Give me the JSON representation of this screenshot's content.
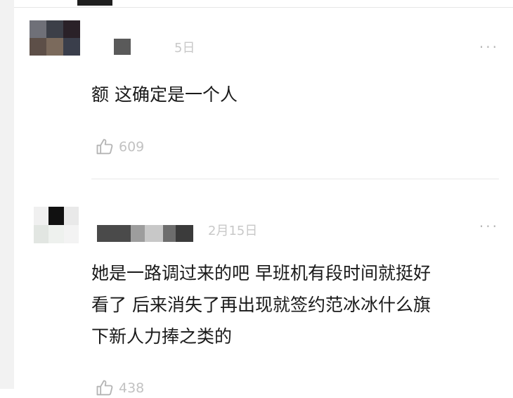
{
  "comments": [
    {
      "time": "5日",
      "text": "额 这确定是一个人",
      "likes": "609",
      "avatar_colors": [
        "#6f7078",
        "#3c3f48",
        "#2a2128",
        "#5d4f48",
        "#7b6a5c",
        "#3a3e4b"
      ],
      "name_block_colors": [
        "#5a5a5a"
      ]
    },
    {
      "time": "2月15日",
      "text_lines": [
        "她是一路调过来的吧 早班机有段时间就挺好",
        "看了 后来消失了再出现就签约范冰冰什么旗",
        "下新人力捧之类的"
      ],
      "likes": "438",
      "avatar_colors": [
        "#f0f0f0",
        "#111111",
        "#e9e9e9",
        "#e2e6e2",
        "#eef1ee",
        "#f3f3f3"
      ],
      "name_block_colors": [
        "#4a4a4a",
        "#9d9d9d",
        "#c8c8c8",
        "#6d6d6d",
        "#3b3b3b"
      ]
    }
  ],
  "ui": {
    "more_label": "···"
  }
}
